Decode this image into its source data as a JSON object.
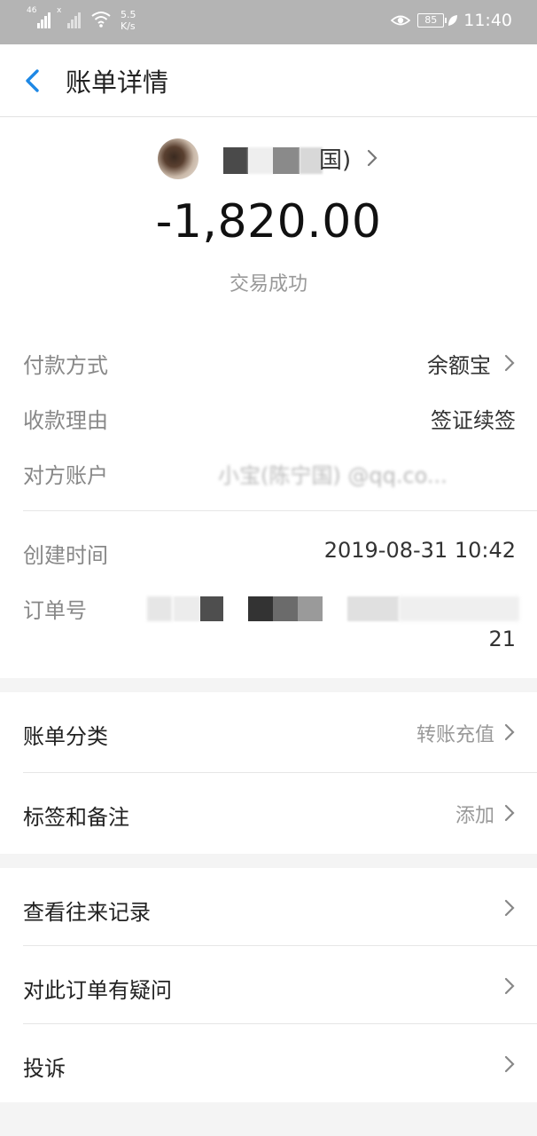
{
  "status_bar": {
    "signal_left_tag": "46",
    "signal_right_tag": "x",
    "speed_value": "5.5",
    "speed_unit": "K/s",
    "battery": "85",
    "time": "11:40"
  },
  "header": {
    "title": "账单详情"
  },
  "summary": {
    "payee_suffix": "国)",
    "amount": "-1,820.00",
    "status": "交易成功"
  },
  "details": {
    "payment_method_label": "付款方式",
    "payment_method_value": "余额宝",
    "reason_label": "收款理由",
    "reason_value": "签证续签",
    "counterparty_label": "对方账户",
    "counterparty_value": "小宝(陈宁国)          @qq.co...",
    "created_label": "创建时间",
    "created_value": "2019-08-31 10:42",
    "order_label": "订单号",
    "order_tail": "21"
  },
  "bill_meta": {
    "category_label": "账单分类",
    "category_value": "转账充值",
    "tags_label": "标签和备注",
    "tags_value": "添加"
  },
  "actions": [
    {
      "label": "查看往来记录"
    },
    {
      "label": "对此订单有疑问"
    },
    {
      "label": "投诉"
    }
  ],
  "colors": {
    "status_bar": "#b4b4b4",
    "accent_blue": "#1e88e5",
    "page_bg": "#f4f4f4"
  },
  "icons": [
    "back-arrow-icon",
    "chevron-right-icon",
    "wifi-icon",
    "eye-icon",
    "battery-icon",
    "leaf-icon"
  ]
}
